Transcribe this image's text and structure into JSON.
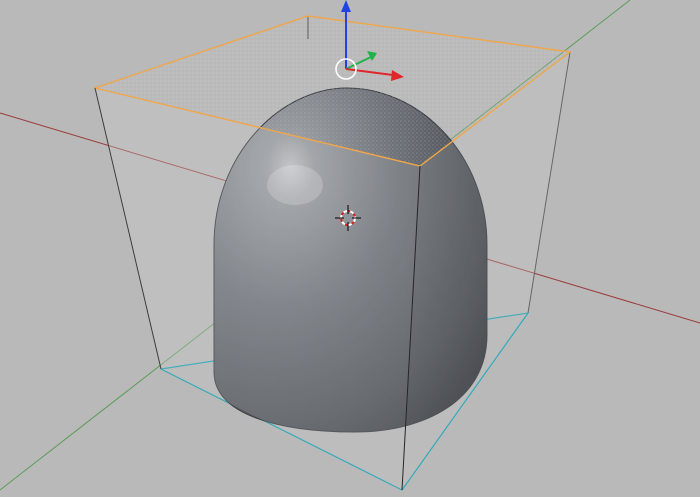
{
  "viewport": {
    "view": "3D viewport",
    "background_color": "#b9b9b9",
    "objects": [
      {
        "name": "dome-mesh",
        "kind": "capsule / dome",
        "color": "#6f7378"
      },
      {
        "name": "box-cage",
        "kind": "transparent cube",
        "selected_face": "top"
      }
    ],
    "axes": {
      "x_axis_color": "#9c3a3a",
      "y_axis_color": "#5c9c5c",
      "bottom_edges_color": "#2aa7b8",
      "selected_edges_color": "#f0a64a"
    },
    "gizmo": {
      "x_color": "#e0262a",
      "y_color": "#22b24c",
      "z_color": "#1f43e8",
      "center_color": "#ffffff"
    },
    "cursor_3d": {
      "color_ring": "#d82323",
      "color_ring_alt": "#ffffff",
      "crosshair_color": "#000000"
    }
  }
}
